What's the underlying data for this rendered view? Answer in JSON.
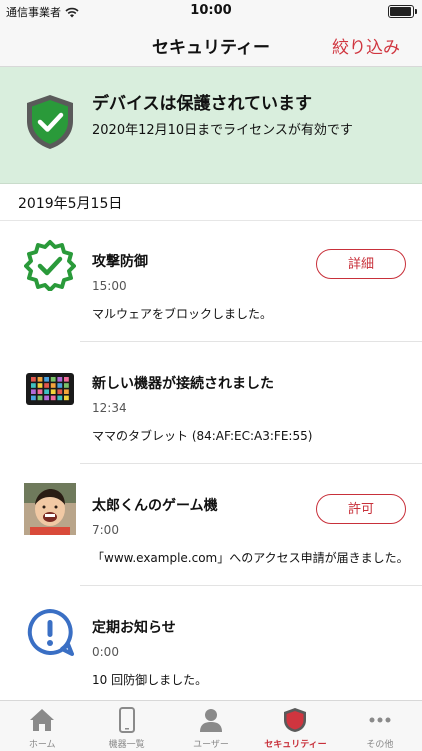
{
  "status_bar": {
    "carrier": "通信事業者",
    "time": "10:00"
  },
  "nav": {
    "title": "セキュリティー",
    "action_label": "絞り込み"
  },
  "banner": {
    "title": "デバイスは保護されています",
    "subtitle": "2020年12月10日までライセンスが有効です",
    "icon": "shield-check-icon"
  },
  "date_header": "2019年5月15日",
  "items": [
    {
      "title": "攻撃防御",
      "time": "15:00",
      "description": "マルウェアをブロックしました。",
      "icon": "badge-check-icon",
      "button": "詳細"
    },
    {
      "title": "新しい機器が接続されました",
      "time": "12:34",
      "description": "ママのタブレット (84:AF:EC:A3:FE:55)",
      "icon": "tablet-icon"
    },
    {
      "title": "太郎くんのゲーム機",
      "time": "7:00",
      "description": "「www.example.com」へのアクセス申請が届きました。",
      "icon": "child-avatar",
      "button": "許可"
    },
    {
      "title": "定期お知らせ",
      "time": "0:00",
      "description": "10 回防御しました。",
      "icon": "exclamation-bubble-icon"
    }
  ],
  "tabs": [
    {
      "label": "ホーム",
      "icon": "home-icon"
    },
    {
      "label": "機器一覧",
      "icon": "phone-icon"
    },
    {
      "label": "ユーザー",
      "icon": "user-icon"
    },
    {
      "label": "セキュリティー",
      "icon": "shield-icon",
      "active": true
    },
    {
      "label": "その他",
      "icon": "more-icon"
    }
  ],
  "colors": {
    "accent": "#c8303a",
    "banner_bg": "#d9eedd",
    "green": "#2a9a3a",
    "info_blue": "#3a6fc4"
  }
}
